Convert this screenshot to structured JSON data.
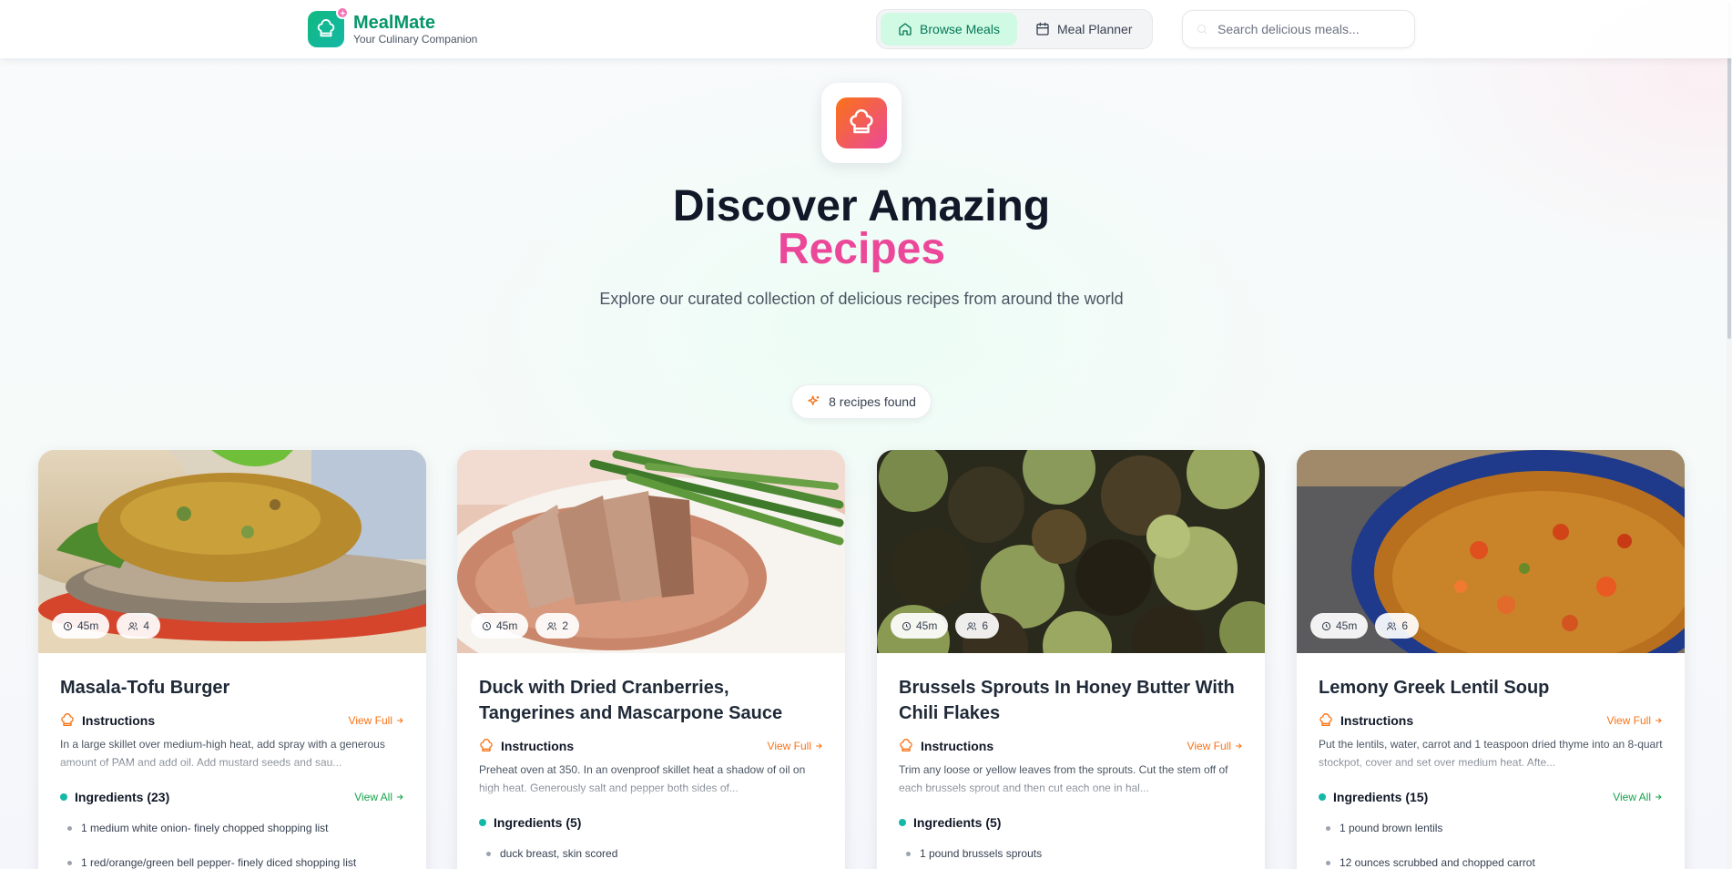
{
  "header": {
    "brand_name": "MealMate",
    "brand_tagline": "Your Culinary Companion",
    "nav": [
      {
        "label": "Browse Meals",
        "icon": "home-icon",
        "active": true
      },
      {
        "label": "Meal Planner",
        "icon": "calendar-icon",
        "active": false
      }
    ],
    "search_placeholder": "Search delicious meals..."
  },
  "hero": {
    "title_line1": "Discover Amazing",
    "title_line2": "Recipes",
    "subtitle": "Explore our curated collection of delicious recipes from around the world"
  },
  "results": {
    "count_label": "8 recipes found"
  },
  "labels": {
    "instructions": "Instructions",
    "view_full": "View Full",
    "view_all": "View All"
  },
  "recipes": [
    {
      "title": "Masala-Tofu Burger",
      "time": "45m",
      "servings": "4",
      "instructions": "In a large skillet over medium-high heat, add spray with a generous amount of PAM and add oil. Add mustard seeds and sau...",
      "ingredients_label": "Ingredients (23)",
      "ingredients": [
        "1 medium white onion- finely chopped shopping list",
        "1 red/orange/green bell pepper- finely diced shopping list"
      ]
    },
    {
      "title": "Duck with Dried Cranberries, Tangerines and Mascarpone Sauce",
      "time": "45m",
      "servings": "2",
      "instructions": "Preheat oven at 350. In an ovenproof skillet heat a shadow of oil on high heat. Generously salt and pepper both sides of...",
      "ingredients_label": "Ingredients (5)",
      "ingredients": [
        "duck breast, skin scored"
      ]
    },
    {
      "title": "Brussels Sprouts In Honey Butter With Chili Flakes",
      "time": "45m",
      "servings": "6",
      "instructions": "Trim any loose or yellow leaves from the sprouts. Cut the stem off of each brussels sprout and then cut each one in hal...",
      "ingredients_label": "Ingredients (5)",
      "ingredients": [
        "1 pound brussels sprouts"
      ]
    },
    {
      "title": "Lemony Greek Lentil Soup",
      "time": "45m",
      "servings": "6",
      "instructions": "Put the lentils, water, carrot and 1 teaspoon dried thyme into an 8-quart stockpot, cover and set over medium heat. Afte...",
      "ingredients_label": "Ingredients (15)",
      "ingredients": [
        "1 pound brown lentils",
        "12 ounces scrubbed and chopped carrot"
      ]
    }
  ],
  "colors": {
    "brand_green": "#059669",
    "accent_pink": "#ec4899",
    "accent_orange": "#f97316",
    "nav_active_bg": "#d1fae5"
  }
}
